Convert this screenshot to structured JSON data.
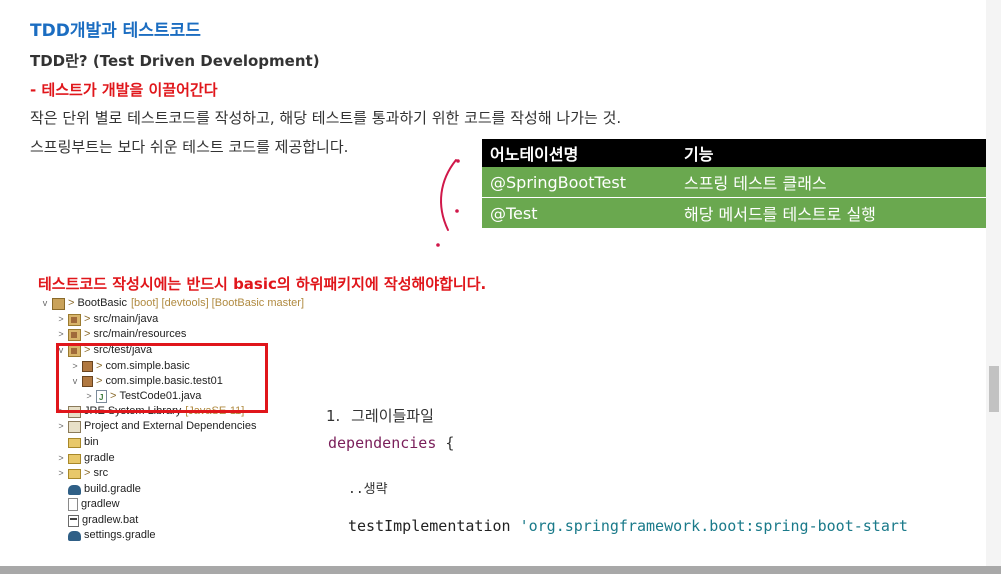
{
  "doc": {
    "title": "TDD개발과 테스트코드",
    "subtitle": "TDD란? (Test Driven Development)",
    "emphasis": "- 테스트가 개발을 이끌어간다",
    "para1": "작은 단위 별로 테스트코드를 작성하고, 해당 테스트를 통과하기 위한 코드를 작성해 나가는 것.",
    "para2": "스프링부트는 보다 쉬운 테스트 코드를 제공합니다.",
    "warning": "테스트코드 작성시에는 반드시 basic의 하위패키지에 작성해야합니다."
  },
  "annotation_table": {
    "headers": [
      "어노테이션명",
      "기능"
    ],
    "rows": [
      [
        "@SpringBootTest",
        "스프링 테스트 클래스"
      ],
      [
        "@Test",
        "해당 메서드를 테스트로 실행"
      ]
    ]
  },
  "tree": {
    "project": {
      "name": "BootBasic",
      "meta": "[boot] [devtools] [BootBasic master]"
    },
    "src_main_java": "src/main/java",
    "src_main_resources": "src/main/resources",
    "src_test_java": "src/test/java",
    "pkg_basic": "com.simple.basic",
    "pkg_test01": "com.simple.basic.test01",
    "test_file": "TestCode01.java",
    "jre": "JRE System Library",
    "jre_meta": "[JavaSE-11]",
    "deps": "Project and External Dependencies",
    "bin": "bin",
    "gradle": "gradle",
    "src": "src",
    "build_gradle": "build.gradle",
    "gradlew": "gradlew",
    "gradlew_bat": "gradlew.bat",
    "settings_gradle": "settings.gradle",
    "prefix": ">"
  },
  "code_section": {
    "number": "1.",
    "label": "그레이들파일",
    "line1_keyword": "dependencies",
    "line1_brace": "{",
    "line2": "..생략",
    "line3_call": "testImplementation",
    "line3_string": "'org.springframework.boot:spring-boot-start"
  },
  "colors": {
    "title": "#1b6dc1",
    "emphasis": "#e0161b",
    "table_header": "#000000",
    "table_row": "#6aa84f",
    "highlight_box": "#e0161b"
  }
}
